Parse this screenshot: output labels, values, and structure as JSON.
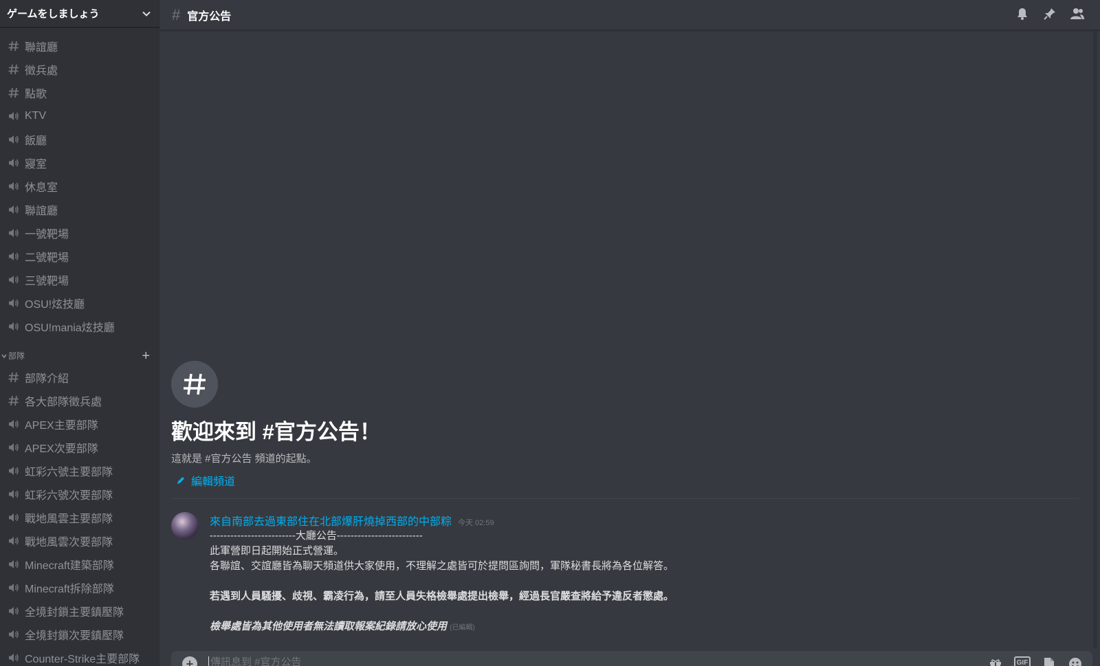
{
  "server": {
    "name": "ゲームをしましょう"
  },
  "channels_top": [
    {
      "type": "text",
      "name": "聯誼廳"
    },
    {
      "type": "text",
      "name": "徵兵處"
    },
    {
      "type": "text",
      "name": "點歌"
    },
    {
      "type": "voice",
      "name": "KTV"
    },
    {
      "type": "voice",
      "name": "飯廳"
    },
    {
      "type": "voice",
      "name": "寢室"
    },
    {
      "type": "voice",
      "name": "休息室"
    },
    {
      "type": "voice",
      "name": "聯誼廳"
    },
    {
      "type": "voice",
      "name": "一號靶場"
    },
    {
      "type": "voice",
      "name": "二號靶場"
    },
    {
      "type": "voice",
      "name": "三號靶場"
    },
    {
      "type": "voice",
      "name": "OSU!炫技廳"
    },
    {
      "type": "voice",
      "name": "OSU!mania炫技廳"
    }
  ],
  "category": {
    "name": "部隊"
  },
  "channels_bottom": [
    {
      "type": "text",
      "name": "部隊介紹"
    },
    {
      "type": "text",
      "name": "各大部隊徵兵處"
    },
    {
      "type": "voice",
      "name": "APEX主要部隊"
    },
    {
      "type": "voice",
      "name": "APEX次要部隊"
    },
    {
      "type": "voice",
      "name": "虹彩六號主要部隊"
    },
    {
      "type": "voice",
      "name": "虹彩六號次要部隊"
    },
    {
      "type": "voice",
      "name": "戰地風雲主要部隊"
    },
    {
      "type": "voice",
      "name": "戰地風雲次要部隊"
    },
    {
      "type": "voice",
      "name": "Minecraft建築部隊"
    },
    {
      "type": "voice",
      "name": "Minecraft拆除部隊"
    },
    {
      "type": "voice",
      "name": "全境封鎖主要鎮壓隊"
    },
    {
      "type": "voice",
      "name": "全境封鎖次要鎮壓隊"
    },
    {
      "type": "voice",
      "name": "Counter-Strike主要部隊"
    }
  ],
  "channel": {
    "title": "官方公告"
  },
  "welcome": {
    "title": "歡迎來到 #官方公告！",
    "subtitle": "這就是 #官方公告 頻道的起點。",
    "edit_label": "編輯頻道"
  },
  "message": {
    "author": "來自南部去過東部住在北部爆肝燒掉西部的中部粽",
    "timestamp": "今天 02:59",
    "line1": "-------------------------大廳公告-------------------------",
    "line2": "此軍營即日起開始正式營運。",
    "line3": "各聯誼、交誼廳皆為聊天頻道供大家使用，不理解之處皆可於提問區詢問，軍隊秘書長將為各位解答。",
    "line4": "若遇到人員騷擾、歧視、霸凌行為，請至人員失格檢舉處提出檢舉，經過長官嚴查將給予違反者懲處。",
    "line5": "檢舉處皆為其他使用者無法讀取報案紀錄請放心使用",
    "edited": "(已編輯)"
  },
  "composer": {
    "placeholder": "傳訊息到 #官方公告"
  },
  "icons": {
    "bell": "bell-icon",
    "pin": "pin-icon",
    "members": "members-icon",
    "gift": "gift-icon",
    "gif": "GIF",
    "sticker": "sticker-icon",
    "emoji": "emoji-icon"
  }
}
